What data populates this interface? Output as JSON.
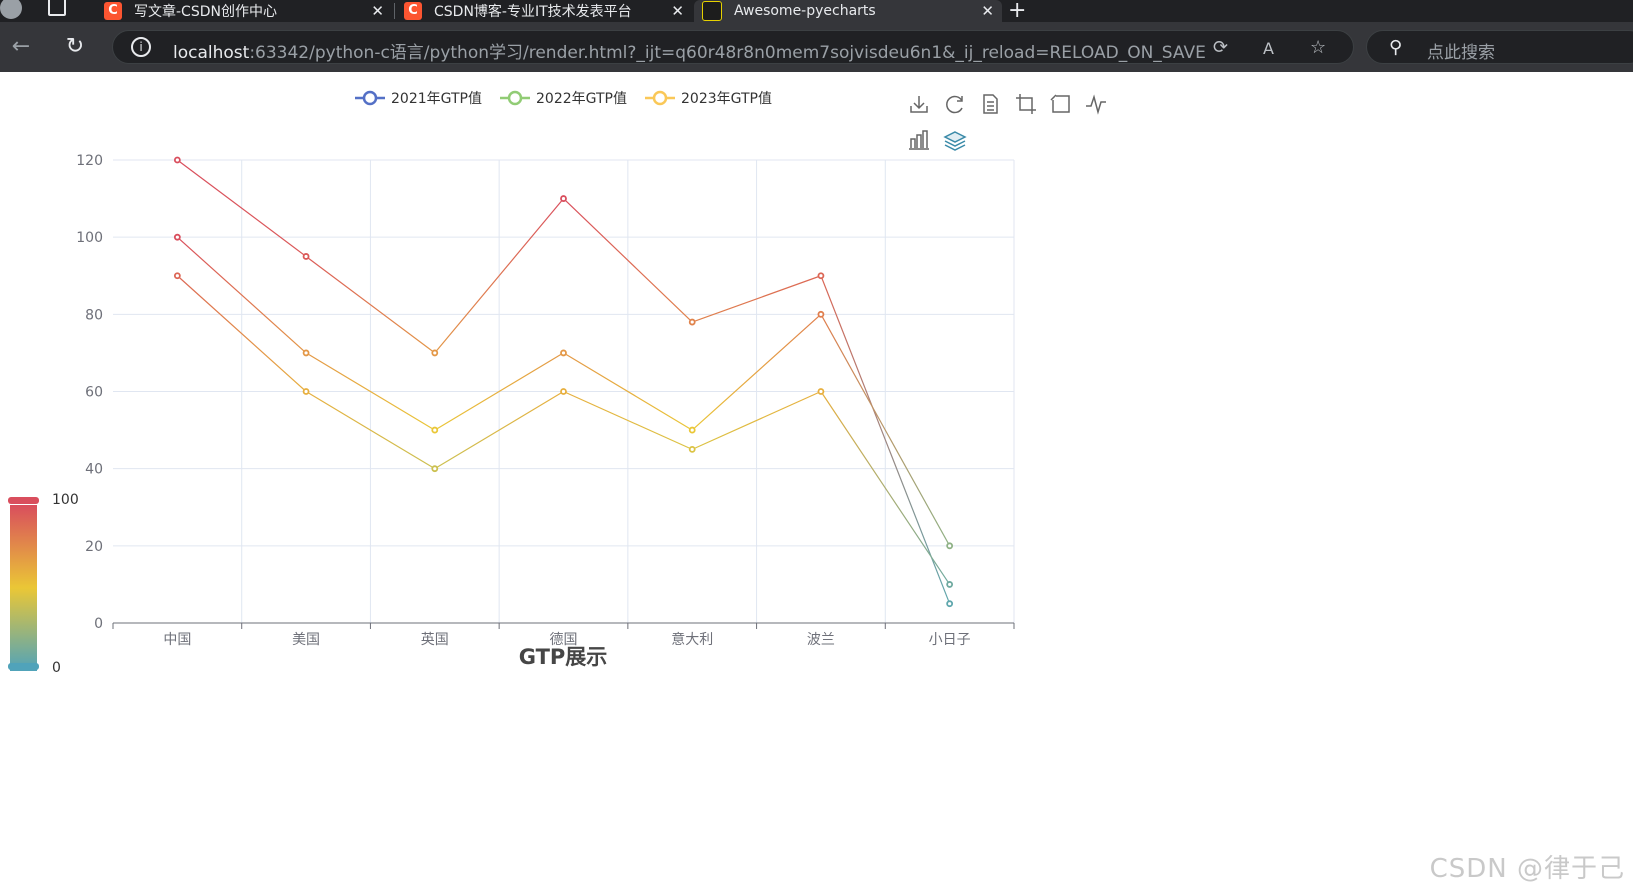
{
  "browser": {
    "tabs": [
      {
        "title": "写文章-CSDN创作中心",
        "icon": "csdn-icon",
        "active": false
      },
      {
        "title": "CSDN博客-专业IT技术发表平台",
        "icon": "csdn-icon",
        "active": false
      },
      {
        "title": "Awesome-pyecharts",
        "icon": "pycharm-icon",
        "active": true
      }
    ],
    "url_host": "localhost",
    "url_rest": ":63342/python-c语言/python学习/render.html?_ijt=q60r48r8n0mem7sojvisdeu6n1&_ij_reload=RELOAD_ON_SAVE",
    "search_placeholder": "点此搜索"
  },
  "chart_data": {
    "type": "line",
    "title": "GTP展示",
    "categories": [
      "中国",
      "美国",
      "英国",
      "德国",
      "意大利",
      "波兰",
      "小日子"
    ],
    "series": [
      {
        "name": "2021年GTP值",
        "values": [
          120,
          95,
          70,
          110,
          78,
          90,
          5
        ]
      },
      {
        "name": "2022年GTP值",
        "values": [
          100,
          70,
          50,
          70,
          50,
          80,
          20
        ]
      },
      {
        "name": "2023年GTP值",
        "values": [
          90,
          60,
          40,
          60,
          45,
          60,
          10
        ]
      }
    ],
    "legend_colors": [
      "#5470c6",
      "#91cc75",
      "#fac858"
    ],
    "ylim": [
      0,
      120
    ],
    "yticks": [
      0,
      20,
      40,
      60,
      80,
      100,
      120
    ],
    "grid": true,
    "legend_position": "top",
    "visual_map": {
      "min": 0,
      "max": 100,
      "min_label": "0",
      "max_label": "100",
      "colors": [
        "#50a3ba",
        "#eac736",
        "#d94e5d"
      ]
    }
  },
  "toolbox": [
    "download-icon",
    "refresh-icon",
    "data-view-icon",
    "zoom-icon",
    "zoom-reset-icon",
    "line-icon",
    "bar-icon",
    "stack-icon"
  ],
  "watermark": "CSDN @律于己"
}
